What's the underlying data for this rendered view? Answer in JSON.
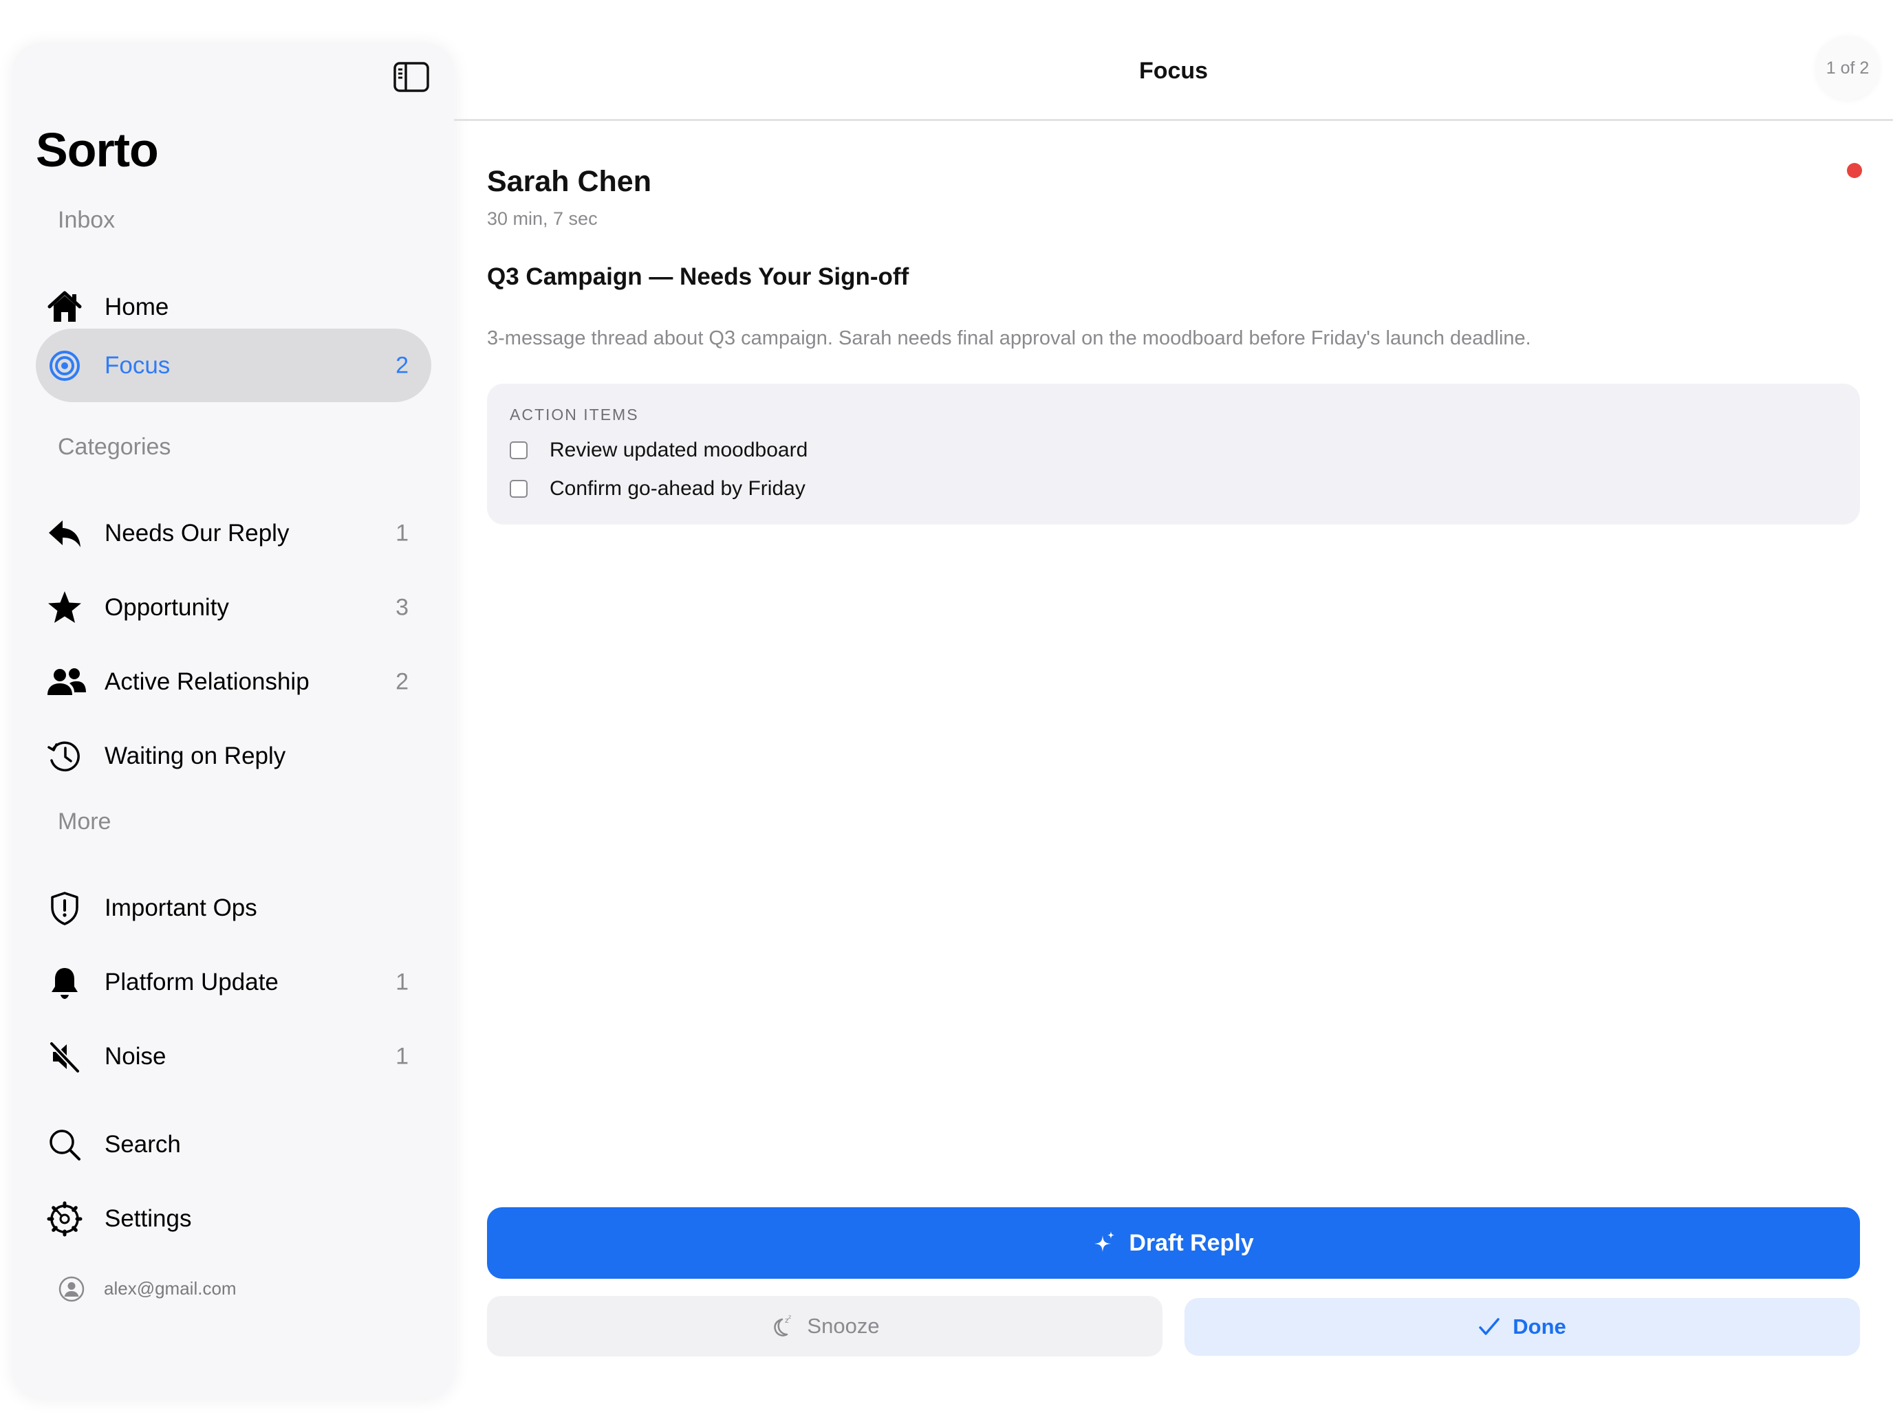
{
  "sidebar": {
    "app_title": "Sorto",
    "sections": {
      "inbox": "Inbox",
      "categories": "Categories",
      "more": "More"
    },
    "items": {
      "home": {
        "label": "Home",
        "icon": "house-icon"
      },
      "focus": {
        "label": "Focus",
        "count": "2",
        "icon": "target-icon",
        "active": true
      },
      "needs_reply": {
        "label": "Needs Our Reply",
        "count": "1",
        "icon": "reply-arrow-icon"
      },
      "opportunity": {
        "label": "Opportunity",
        "count": "3",
        "icon": "star-icon"
      },
      "active_relationship": {
        "label": "Active Relationship",
        "count": "2",
        "icon": "people-icon"
      },
      "waiting_reply": {
        "label": "Waiting on Reply",
        "icon": "clock-history-icon"
      },
      "important_ops": {
        "label": "Important Ops",
        "icon": "shield-exclamation-icon"
      },
      "platform_update": {
        "label": "Platform Update",
        "count": "1",
        "icon": "bell-icon"
      },
      "noise": {
        "label": "Noise",
        "count": "1",
        "icon": "speaker-mute-icon"
      },
      "search": {
        "label": "Search",
        "icon": "search-icon"
      },
      "settings": {
        "label": "Settings",
        "icon": "gear-icon"
      }
    },
    "account": "alex@gmail.com"
  },
  "header": {
    "title": "Focus",
    "pager": "1 of 2"
  },
  "email": {
    "sender": "Sarah Chen",
    "elapsed": "30 min, 7 sec",
    "subject": "Q3 Campaign — Needs Your Sign-off",
    "summary": "3-message thread about Q3 campaign. Sarah needs final approval on the moodboard before Friday's launch deadline.",
    "unread": true,
    "action_items": {
      "heading": "ACTION ITEMS",
      "items": [
        {
          "text": "Review updated moodboard",
          "checked": false
        },
        {
          "text": "Confirm go-ahead by Friday",
          "checked": false
        }
      ]
    }
  },
  "actions": {
    "draft_reply": "Draft Reply",
    "snooze": "Snooze",
    "done": "Done"
  },
  "colors": {
    "accent": "#1b6ff0",
    "active_text": "#2f7cf6",
    "unread_dot": "#e8433f",
    "secondary_text": "#8a8a8e"
  }
}
